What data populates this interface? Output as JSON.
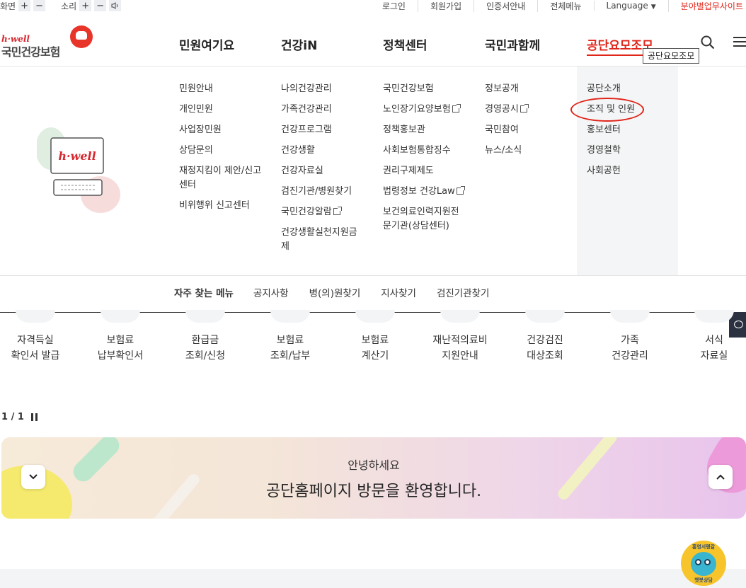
{
  "utility": {
    "screen_label": "화면",
    "sound_label": "소리",
    "plus": "+",
    "minus": "−",
    "links": [
      "로그인",
      "회원가입",
      "인증서안내",
      "전체메뉴"
    ],
    "language": "Language",
    "field_sites": "분야별업무사이트",
    "accent_color": "#e0251a"
  },
  "logo": {
    "brand": "h·well",
    "name": "국민건강보험"
  },
  "gnb": {
    "items": [
      "민원여기요",
      "건강iN",
      "정책센터",
      "국민과함께",
      "공단요모조모"
    ],
    "active_index": 4,
    "tooltip": "공단요모조모"
  },
  "illustration": {
    "screen_text": "h·well"
  },
  "mega_menu": {
    "col1": [
      "민원안내",
      "개인민원",
      "사업장민원",
      "상담문의",
      "재정지킴이 제안/신고센터",
      "비위행위 신고센터"
    ],
    "col2": [
      "나의건강관리",
      "가족건강관리",
      "건강프로그램",
      "건강생활",
      "건강자료실",
      "검진기관/병원찾기",
      "국민건강알람",
      "건강생활실천지원금제"
    ],
    "col3": [
      "국민건강보험",
      "노인장기요양보험",
      "정책홍보관",
      "사회보험통합징수",
      "권리구제제도",
      "법령정보 건강Law",
      "보건의료인력지원전문기관(상담센터)"
    ],
    "col4": [
      "정보공개",
      "경영공시",
      "국민참여",
      "뉴스/소식"
    ],
    "col5": [
      "공단소개",
      "조직 및 인원",
      "홍보센터",
      "경영철학",
      "사회공헌"
    ]
  },
  "quick_menu": {
    "label": "자주 찾는 메뉴",
    "items": [
      "공지사항",
      "병(의)원찾기",
      "지사찾기",
      "검진기관찾기"
    ]
  },
  "services": [
    [
      "자격득실",
      "확인서 발급"
    ],
    [
      "보험료",
      "납부확인서"
    ],
    [
      "환급금",
      "조회/신청"
    ],
    [
      "보험료",
      "조회/납부"
    ],
    [
      "보험료",
      "계산기"
    ],
    [
      "재난적의료비",
      "지원안내"
    ],
    [
      "건강검진",
      "대상조회"
    ],
    [
      "가족",
      "건강관리"
    ],
    [
      "서식",
      "자료실"
    ]
  ],
  "pager": {
    "text": "1 / 1"
  },
  "banner": {
    "line1": "안녕하세요",
    "line2": "공단홈페이지 방문을 환영합니다."
  },
  "mascot": {
    "top_text": "홍영서평갈",
    "bottom_text": "챗봇상담"
  }
}
